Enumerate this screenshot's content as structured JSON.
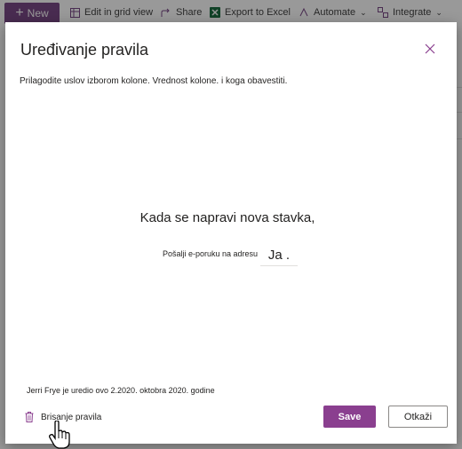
{
  "commandbar": {
    "new_label": "New",
    "items": [
      {
        "label": "Edit in grid view",
        "icon": "grid-icon"
      },
      {
        "label": "Share",
        "icon": "share-icon"
      },
      {
        "label": "Export to Excel",
        "icon": "excel-icon"
      },
      {
        "label": "Automate",
        "icon": "automate-icon"
      },
      {
        "label": "Integrate",
        "icon": "integrate-icon"
      }
    ]
  },
  "dialog": {
    "title": "Uređivanje pravila",
    "subtitle": "Prilagodite uslov izborom kolone. Vrednost kolone. i koga obavestiti.",
    "condition": "Kada se napravi nova stavka,",
    "action_label": "Pošalji e-poruku na adresu",
    "recipient": "Ja .",
    "edited_info": "Jerri Frye je uredio ovo 2.2020. oktobra 2020. godine",
    "delete_label": "Brisanje pravila",
    "save_label": "Save",
    "cancel_label": "Otkaži"
  },
  "colors": {
    "accent": "#8a3f8f",
    "new_button": "#7a4a87"
  }
}
